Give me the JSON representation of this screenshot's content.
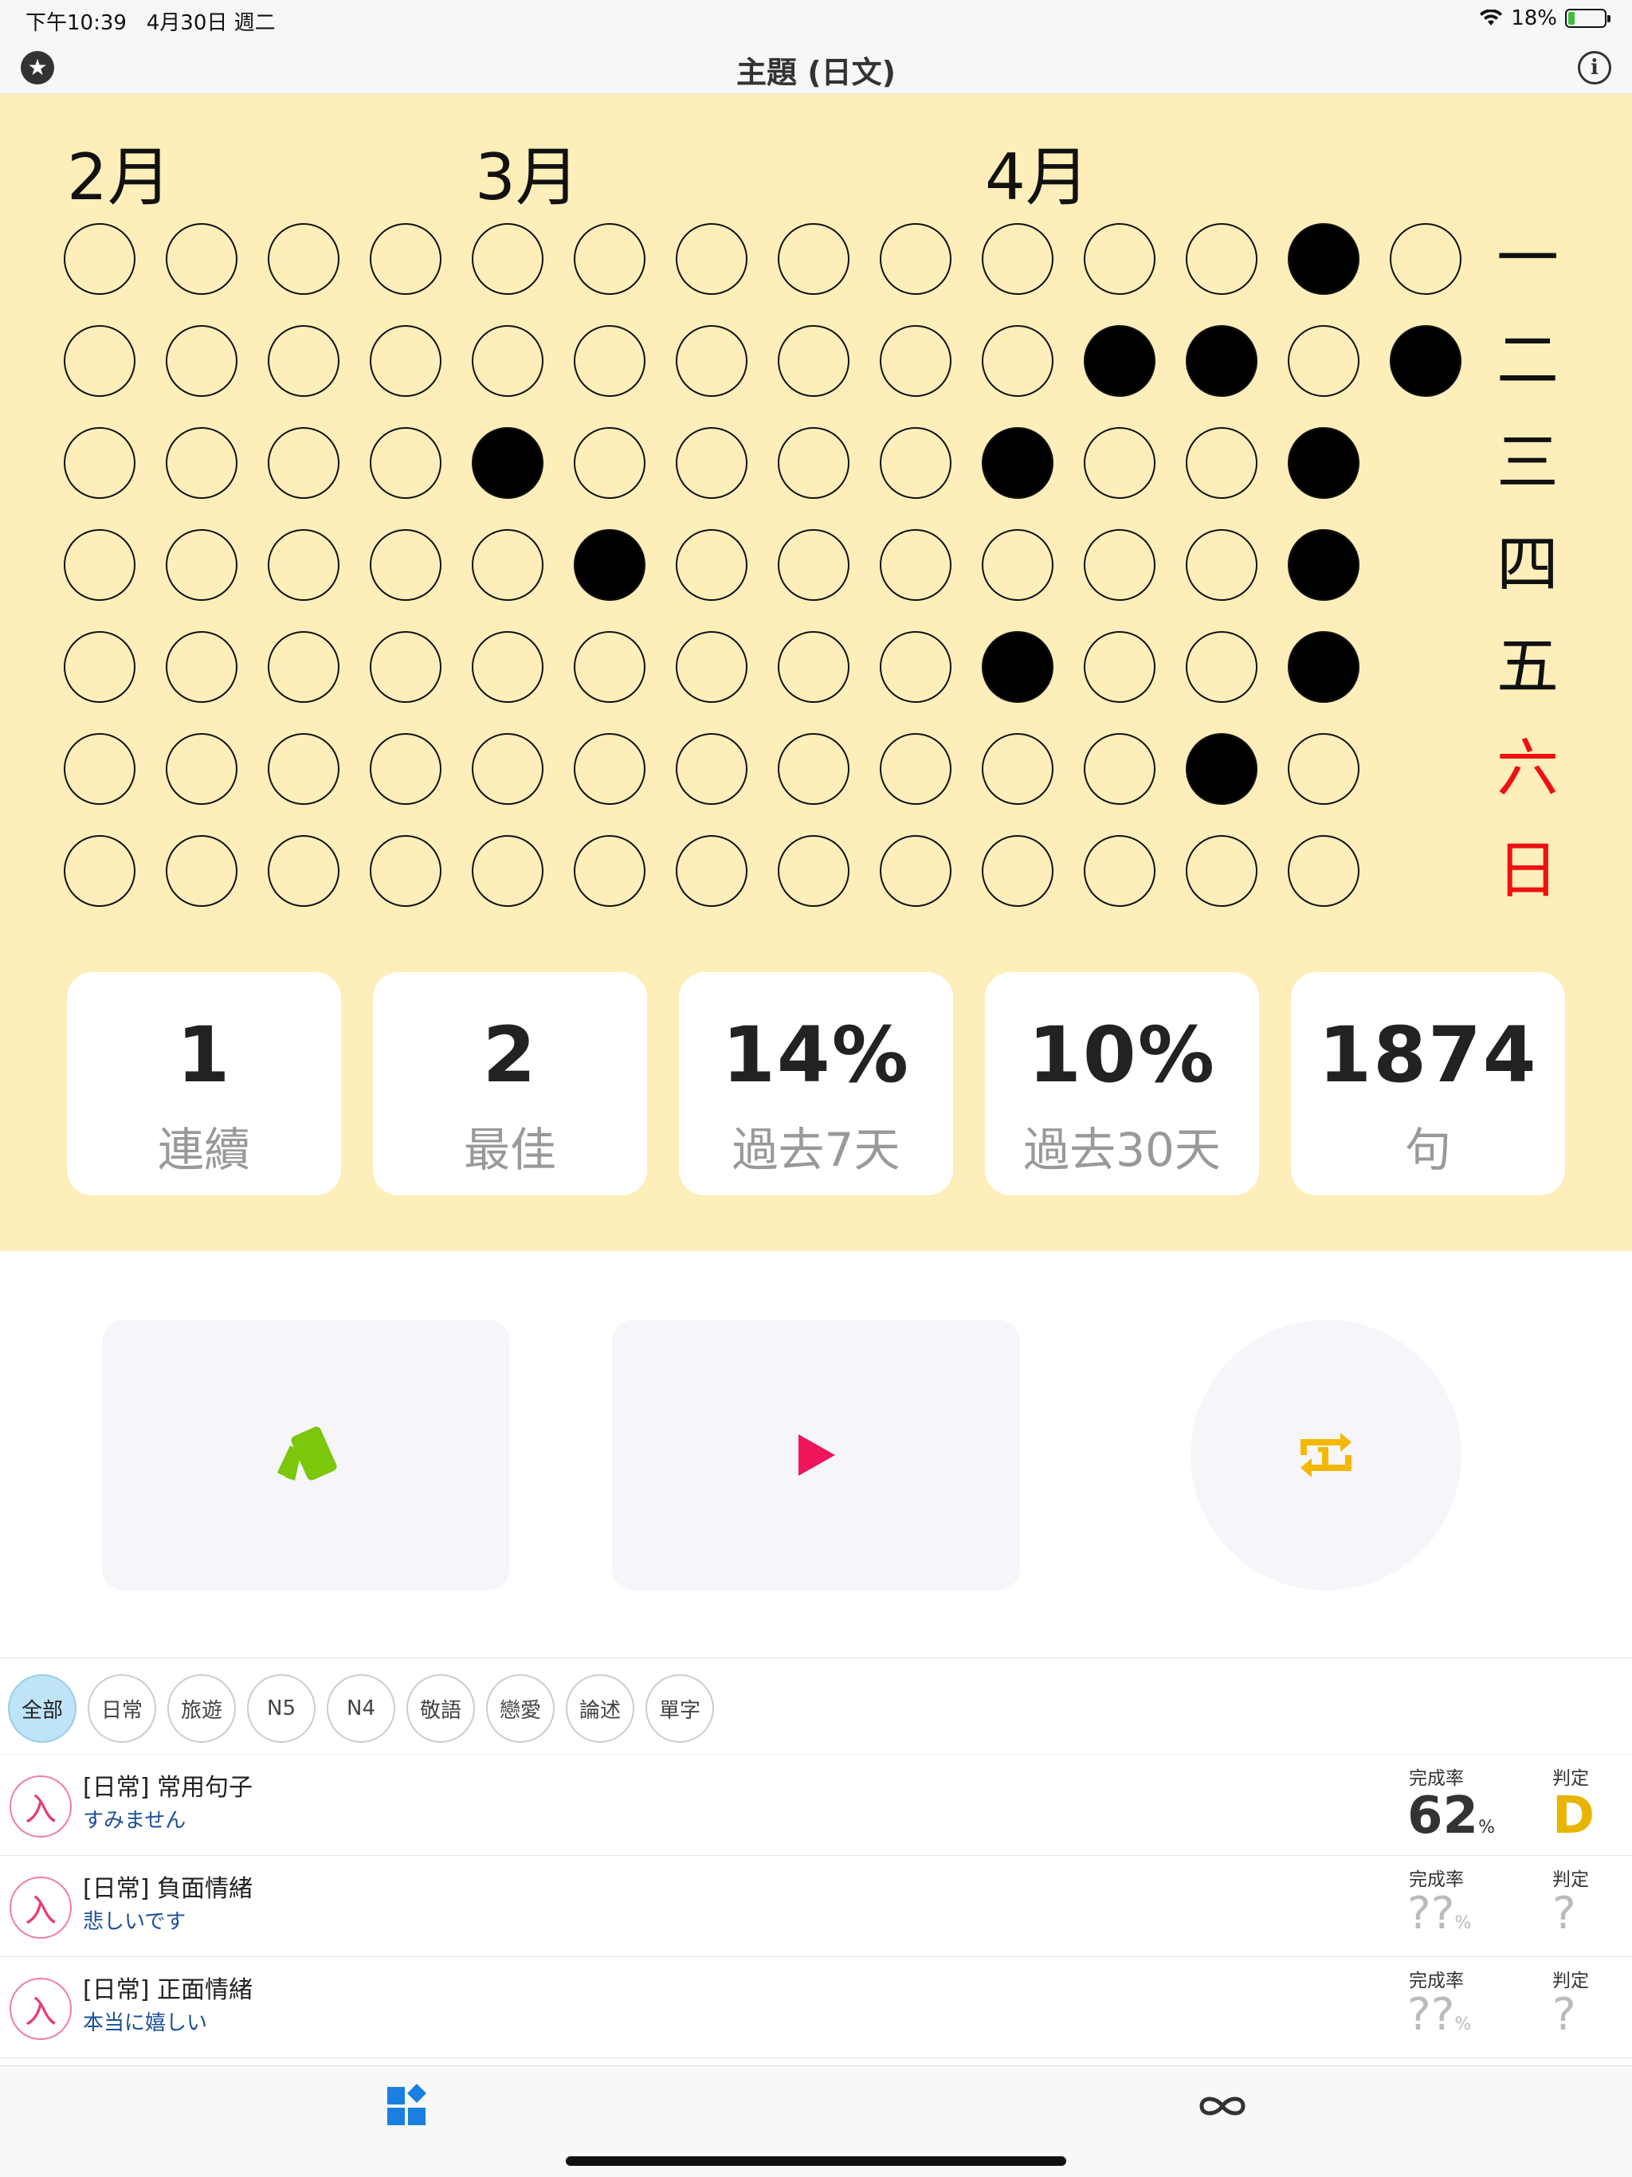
{
  "status": {
    "time": "下午10:39",
    "date": "4月30日 週二",
    "battery": "18%",
    "battery_level": 0.18
  },
  "nav": {
    "title": "主題 (日文)",
    "star_icon": "star-icon",
    "info_icon": "info-icon"
  },
  "calendar": {
    "months": [
      "2月",
      "3月",
      "4月"
    ],
    "weekdays": [
      {
        "label": "一",
        "color": "#111111"
      },
      {
        "label": "二",
        "color": "#111111"
      },
      {
        "label": "三",
        "color": "#111111"
      },
      {
        "label": "四",
        "color": "#111111"
      },
      {
        "label": "五",
        "color": "#111111"
      },
      {
        "label": "六",
        "color": "#ee1111"
      },
      {
        "label": "日",
        "color": "#ee1111"
      }
    ],
    "weeks": [
      [
        0,
        0,
        0,
        0,
        0,
        0,
        0
      ],
      [
        0,
        0,
        0,
        0,
        0,
        0,
        0
      ],
      [
        0,
        0,
        0,
        0,
        0,
        0,
        0
      ],
      [
        0,
        0,
        0,
        0,
        0,
        0,
        0
      ],
      [
        0,
        0,
        1,
        0,
        0,
        0,
        0
      ],
      [
        0,
        0,
        0,
        1,
        0,
        0,
        0
      ],
      [
        0,
        0,
        0,
        0,
        0,
        0,
        0
      ],
      [
        0,
        0,
        0,
        0,
        0,
        0,
        0
      ],
      [
        0,
        0,
        0,
        0,
        0,
        0,
        0
      ],
      [
        0,
        0,
        1,
        0,
        1,
        0,
        0
      ],
      [
        0,
        1,
        0,
        0,
        0,
        0,
        0
      ],
      [
        0,
        1,
        0,
        0,
        0,
        1,
        0
      ],
      [
        1,
        0,
        1,
        1,
        1,
        0,
        0
      ],
      [
        0,
        1,
        null,
        null,
        null,
        null,
        null
      ]
    ]
  },
  "stats": [
    {
      "value": "1",
      "label": "連續"
    },
    {
      "value": "2",
      "label": "最佳"
    },
    {
      "value": "14%",
      "label": "過去7天"
    },
    {
      "value": "10%",
      "label": "過去30天"
    },
    {
      "value": "1874",
      "label": "句"
    }
  ],
  "actions": {
    "cards_icon": "flashcards-icon",
    "play_icon": "play-icon",
    "repeat_icon": "repeat-one-icon",
    "cards_color": "#7ac70c",
    "play_color": "#f0145a",
    "repeat_color": "#f5b800"
  },
  "filters": [
    "全部",
    "日常",
    "旅遊",
    "N5",
    "N4",
    "敬語",
    "戀愛",
    "論述",
    "單字"
  ],
  "lessons": [
    {
      "badge": "入",
      "title": "[日常] 常用句子",
      "subtitle": "すみません",
      "rate_label": "完成率",
      "rate": "62",
      "pct": "%",
      "grade_label": "判定",
      "grade": "D",
      "known": true
    },
    {
      "badge": "入",
      "title": "[日常] 負面情緒",
      "subtitle": "悲しいです",
      "rate_label": "完成率",
      "rate": "??",
      "pct": "%",
      "grade_label": "判定",
      "grade": "?",
      "known": false
    },
    {
      "badge": "入",
      "title": "[日常] 正面情緒",
      "subtitle": "本当に嬉しい",
      "rate_label": "完成率",
      "rate": "??",
      "pct": "%",
      "grade_label": "判定",
      "grade": "?",
      "known": false
    }
  ],
  "tabbar": {
    "home_icon": "dashboard-icon",
    "loop_icon": "infinity-icon",
    "home_color": "#1a7fe0"
  }
}
